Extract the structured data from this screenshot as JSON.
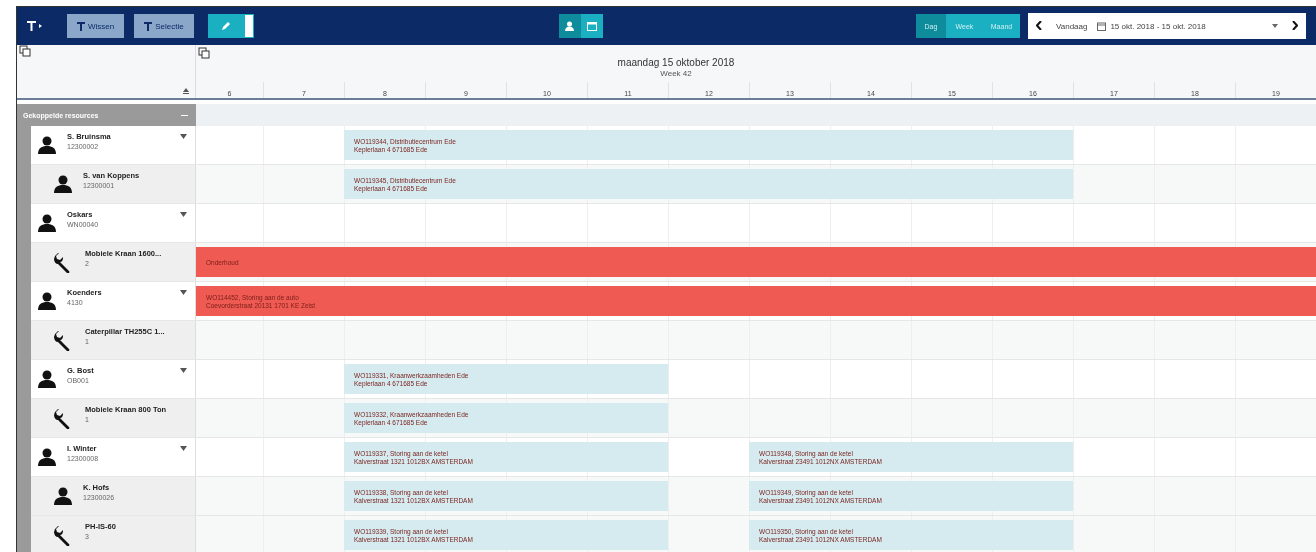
{
  "toolbar": {
    "filter_buttons": [
      {
        "label": "Wissen"
      },
      {
        "label": "Selectie"
      }
    ],
    "edit_mode": true,
    "resource_views": [
      {
        "kind": "person",
        "selected": true
      },
      {
        "kind": "calendar",
        "selected": false
      }
    ],
    "periods": [
      {
        "label": "Dag",
        "selected": true
      },
      {
        "label": "Week",
        "selected": false
      },
      {
        "label": "Maand",
        "selected": false
      }
    ],
    "today": "Vandaag",
    "date_range": "15 okt. 2018 - 15 okt. 2018"
  },
  "header": {
    "date": "maandag 15 oktober 2018",
    "week": "Week 42",
    "hours": [
      "6",
      "7",
      "8",
      "9",
      "10",
      "11",
      "12",
      "13",
      "14",
      "15",
      "16",
      "17",
      "18",
      "19"
    ]
  },
  "group": {
    "title": "Gekoppelde resources",
    "expanded": true
  },
  "resources": [
    {
      "name": "S. Bruinsma",
      "code": "12300002",
      "kind": "person",
      "expanded": true,
      "timeline": [
        {
          "kind": "free"
        },
        {
          "kind": "free"
        },
        {
          "kind": "event",
          "title": "WO119344, Distributiecentrum Ede",
          "address": "Keplerlaan 4 671685 Ede",
          "color": "#d5ebf0"
        },
        {
          "kind": "continued"
        },
        {
          "kind": "continued"
        },
        {
          "kind": "continued"
        },
        {
          "kind": "continued"
        },
        {
          "kind": "continued"
        },
        {
          "kind": "continued"
        },
        {
          "kind": "continued"
        },
        {
          "kind": "continued"
        }
      ],
      "children": [
        {
          "name": "S. van Koppens",
          "code": "12300001",
          "kind": "person",
          "timeline": [
            {
              "kind": "free"
            },
            {
              "kind": "free"
            },
            {
              "kind": "event",
              "title": "WO119345, Distributiecentrum Ede",
              "address": "Keplerlaan 4 671685 Ede",
              "color": "#d5ebf0"
            },
            {
              "kind": "continued"
            },
            {
              "kind": "continued"
            },
            {
              "kind": "continued"
            },
            {
              "kind": "continued"
            },
            {
              "kind": "continued"
            },
            {
              "kind": "continued"
            },
            {
              "kind": "continued"
            },
            {
              "kind": "continued"
            }
          ]
        }
      ]
    },
    {
      "name": "Oskars",
      "code": "WN00040",
      "kind": "person",
      "expanded": true,
      "children": [
        {
          "name": "Mobiele Kraan 1600...",
          "code": "2",
          "kind": "equipment",
          "timeline": [
            {
              "kind": "event",
              "title": "Onderhoud",
              "color": "#ef5a52"
            },
            {
              "kind": "continued"
            },
            {
              "kind": "continued"
            },
            {
              "kind": "continued"
            },
            {
              "kind": "continued"
            },
            {
              "kind": "continued"
            },
            {
              "kind": "continued"
            },
            {
              "kind": "continued"
            },
            {
              "kind": "continued"
            },
            {
              "kind": "continued"
            },
            {
              "kind": "continued"
            },
            {
              "kind": "continued"
            },
            {
              "kind": "continued"
            },
            {
              "kind": "continued"
            }
          ]
        }
      ]
    },
    {
      "name": "Koenders",
      "code": "4130",
      "kind": "person",
      "expanded": true,
      "timeline": [
        {
          "kind": "event",
          "title": "WO114452, Storing aan de auto",
          "address": "Coevorderstraat 20131 1701 KE Zeist",
          "color": "#ef5a52"
        },
        {
          "kind": "continued"
        },
        {
          "kind": "continued"
        },
        {
          "kind": "continued"
        },
        {
          "kind": "continued"
        },
        {
          "kind": "continued"
        },
        {
          "kind": "continued"
        },
        {
          "kind": "continued"
        },
        {
          "kind": "continued"
        },
        {
          "kind": "continued"
        },
        {
          "kind": "continued"
        },
        {
          "kind": "continued"
        },
        {
          "kind": "continued"
        },
        {
          "kind": "continued"
        }
      ],
      "children": [
        {
          "name": "Caterpillar TH255C 1...",
          "code": "1",
          "kind": "equipment"
        }
      ]
    },
    {
      "name": "G. Bost",
      "code": "OB001",
      "kind": "person",
      "expanded": true,
      "timeline": [
        {
          "kind": "free"
        },
        {
          "kind": "free"
        },
        {
          "kind": "event",
          "title": "WO119331, Kraanwerkzaamheden Ede",
          "address": "Keplerlaan 4 671685 Ede",
          "color": "#d5ebf0"
        },
        {
          "kind": "continued"
        },
        {
          "kind": "continued"
        },
        {
          "kind": "continued"
        }
      ],
      "children": [
        {
          "name": "Mobiele Kraan 800 Ton",
          "code": "1",
          "kind": "equipment",
          "timeline": [
            {
              "kind": "free"
            },
            {
              "kind": "free"
            },
            {
              "kind": "event",
              "title": "WO119332, Kraanwerkzaamheden Ede",
              "address": "Keplerlaan 4 671685 Ede",
              "color": "#d5ebf0"
            },
            {
              "kind": "continued"
            },
            {
              "kind": "continued"
            },
            {
              "kind": "continued"
            }
          ]
        }
      ]
    },
    {
      "name": "I. Winter",
      "code": "12300008",
      "kind": "person",
      "expanded": true,
      "timeline": [
        {
          "kind": "free"
        },
        {
          "kind": "free"
        },
        {
          "kind": "event",
          "title": "WO119337, Storing aan de ketel",
          "address": "Kalverstraat 1321 1012BX AMSTERDAM",
          "color": "#d5ebf0"
        },
        {
          "kind": "continued"
        },
        {
          "kind": "continued"
        },
        {
          "kind": "continued"
        },
        {
          "kind": "free"
        },
        {
          "kind": "event",
          "title": "WO119348, Storing aan de ketel",
          "address": "Kalverstraat 23491 1012NX AMSTERDAM",
          "color": "#d5ebf0"
        },
        {
          "kind": "continued"
        },
        {
          "kind": "continued"
        },
        {
          "kind": "continued"
        }
      ],
      "children": [
        {
          "name": "K. Hofs",
          "code": "12300026",
          "kind": "person",
          "timeline": [
            {
              "kind": "free"
            },
            {
              "kind": "free"
            },
            {
              "kind": "event",
              "title": "WO119338, Storing aan de ketel",
              "address": "Kalverstraat 1321 1012BX AMSTERDAM",
              "color": "#d5ebf0"
            },
            {
              "kind": "continued"
            },
            {
              "kind": "continued"
            },
            {
              "kind": "continued"
            },
            {
              "kind": "free"
            },
            {
              "kind": "event",
              "title": "WO119349, Storing aan de ketel",
              "address": "Kalverstraat 23491 1012NX AMSTERDAM",
              "color": "#d5ebf0"
            },
            {
              "kind": "continued"
            },
            {
              "kind": "continued"
            },
            {
              "kind": "continued"
            }
          ]
        },
        {
          "name": "PH-IS-60",
          "code": "3",
          "kind": "equipment",
          "timeline": [
            {
              "kind": "free"
            },
            {
              "kind": "free"
            },
            {
              "kind": "event",
              "title": "WO119339, Storing aan de ketel",
              "address": "Kalverstraat 1321 1012BX AMSTERDAM",
              "color": "#d5ebf0"
            },
            {
              "kind": "continued"
            },
            {
              "kind": "continued"
            },
            {
              "kind": "continued"
            },
            {
              "kind": "free"
            },
            {
              "kind": "event",
              "title": "WO119350, Storing aan de ketel",
              "address": "Kalverstraat 23491 1012NX AMSTERDAM",
              "color": "#d5ebf0"
            },
            {
              "kind": "continued"
            },
            {
              "kind": "continued"
            },
            {
              "kind": "continued"
            }
          ]
        }
      ]
    }
  ]
}
